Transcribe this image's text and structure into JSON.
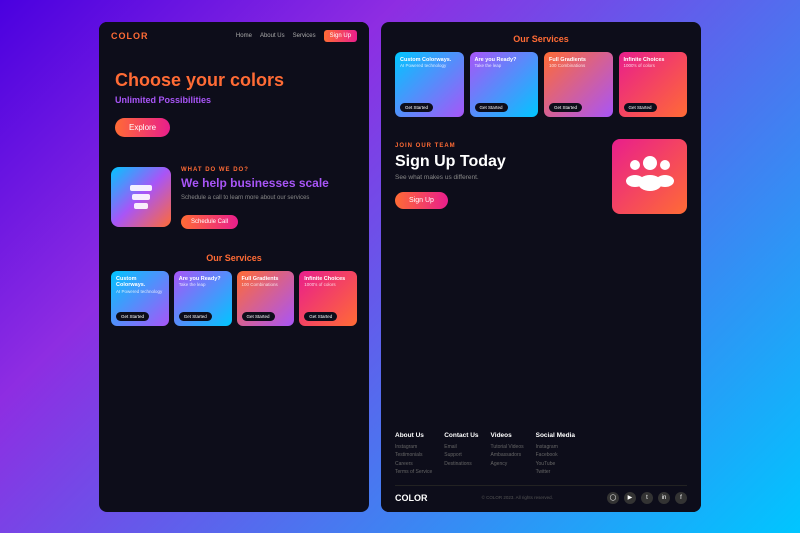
{
  "brand": {
    "logo": "COLOR",
    "tagline": "Unlimited Possibilities"
  },
  "nav": {
    "links": [
      "Home",
      "About Us",
      "Services"
    ],
    "signup_label": "Sign Up"
  },
  "hero": {
    "title_plain": "Choose your ",
    "title_colored": "colors",
    "subtitle": "Unlimited Possibilities",
    "cta": "Explore"
  },
  "what_section": {
    "tag": "WHAT DO WE DO?",
    "title": "We help businesses scale",
    "description": "Schedule a call to learn more about our services",
    "cta": "Schedule Call"
  },
  "services_section_left": {
    "title": "Our Services",
    "cards": [
      {
        "name": "Custom Colorways.",
        "sub": "AI Powered technology",
        "btn": "Get Started"
      },
      {
        "name": "Are you Ready?",
        "sub": "Take the leap",
        "btn": "Get Started"
      },
      {
        "name": "Full Gradients",
        "sub": "100 Combinations",
        "btn": "Get Started"
      },
      {
        "name": "Infinite Choices",
        "sub": "1000's of colors",
        "btn": "Get Started"
      }
    ]
  },
  "services_section_right": {
    "title": "Our Services",
    "cards": [
      {
        "name": "Custom Colorways.",
        "sub": "AI Powered technology",
        "btn": "Get Started"
      },
      {
        "name": "Are you Ready?",
        "sub": "Take the leap",
        "btn": "Get Started"
      },
      {
        "name": "Full Gradients",
        "sub": "100 Combinations",
        "btn": "Get Started"
      },
      {
        "name": "Infinite Choices",
        "sub": "1000's of colors",
        "btn": "Get Started"
      }
    ]
  },
  "signup_section": {
    "tag": "JOIN OUR TEAM",
    "title": "Sign Up Today",
    "sub": "See what makes us different.",
    "cta": "Sign Up"
  },
  "footer": {
    "logo": "COLOR",
    "copyright": "© COLOR 2023. All rights reserved.",
    "cols": [
      {
        "title": "About Us",
        "items": [
          "Instagram",
          "Testimonials",
          "Careers",
          "Terms of Service"
        ]
      },
      {
        "title": "Contact Us",
        "items": [
          "Email",
          "Support",
          "Destinations"
        ]
      },
      {
        "title": "Videos",
        "items": [
          "Tutorial Videos",
          "Ambassadors",
          "Agency"
        ]
      },
      {
        "title": "Social Media",
        "items": [
          "Instagram",
          "Facebook",
          "YouTube",
          "Twitter"
        ]
      }
    ],
    "social_icons": [
      "ⓘ",
      "▶",
      "t",
      "in",
      "f"
    ]
  }
}
